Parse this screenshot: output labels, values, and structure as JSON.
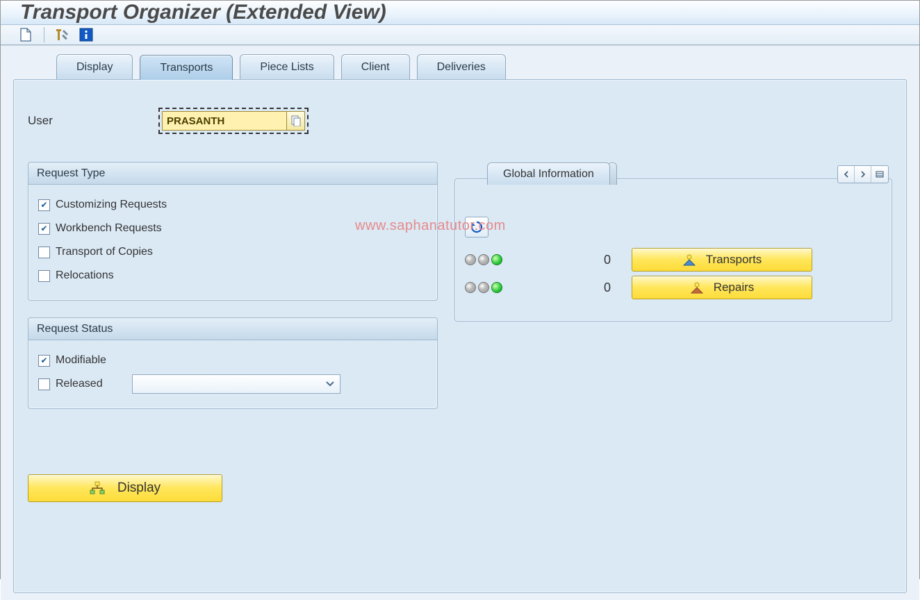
{
  "title": "Transport Organizer (Extended View)",
  "toolbar": {
    "icons": [
      "new-document-icon",
      "tools-icon",
      "info-icon"
    ]
  },
  "tabs": [
    {
      "label": "Display",
      "active": false
    },
    {
      "label": "Transports",
      "active": true
    },
    {
      "label": "Piece Lists",
      "active": false
    },
    {
      "label": "Client",
      "active": false
    },
    {
      "label": "Deliveries",
      "active": false
    }
  ],
  "user": {
    "label": "User",
    "value": "PRASANTH"
  },
  "request_type": {
    "title": "Request Type",
    "items": [
      {
        "label": "Customizing Requests",
        "checked": true
      },
      {
        "label": "Workbench Requests",
        "checked": true
      },
      {
        "label": "Transport of Copies",
        "checked": false
      },
      {
        "label": "Relocations",
        "checked": false
      }
    ]
  },
  "request_status": {
    "title": "Request Status",
    "items": [
      {
        "label": "Modifiable",
        "checked": true
      },
      {
        "label": "Released",
        "checked": false
      }
    ],
    "release_select_value": ""
  },
  "global_info": {
    "tab_label": "Global Information",
    "rows": [
      {
        "count": "0",
        "button_label": "Transports"
      },
      {
        "count": "0",
        "button_label": "Repairs"
      }
    ]
  },
  "display_button": {
    "label": "Display"
  },
  "watermark": "www.saphanatutor.com"
}
